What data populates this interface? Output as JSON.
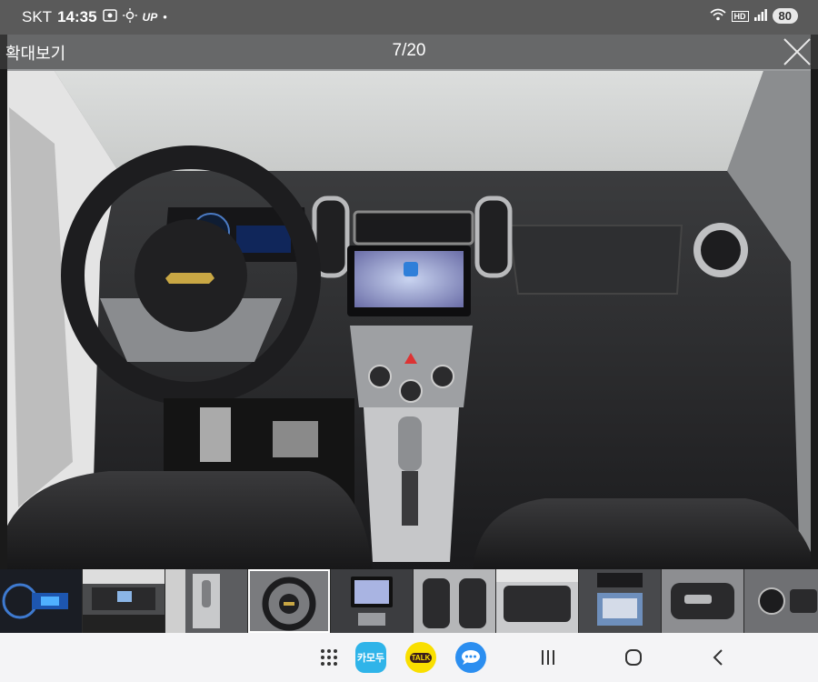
{
  "status_bar": {
    "carrier": "SKT",
    "time": "14:35",
    "indicators": [
      "screen-record-icon",
      "sun-icon",
      "up-icon",
      "dot-icon"
    ],
    "up_label": "UP",
    "network_label": "HD",
    "battery": "80"
  },
  "viewer": {
    "title": "확대보기",
    "counter": "7/20",
    "close_icon": "close-icon"
  },
  "thumbnails": {
    "count_visible": 10,
    "active_index": 3
  },
  "nav_bar": {
    "apps": [
      {
        "name": "app-drawer-icon",
        "label": ""
      },
      {
        "name": "kakao-t-icon",
        "label": "카모두",
        "color": "#2fb4e9"
      },
      {
        "name": "kakaotalk-icon",
        "label": "TALK",
        "color": "#f9df00"
      },
      {
        "name": "messages-icon",
        "label": "",
        "color": "#2b8ef0"
      }
    ],
    "buttons": [
      "recents-icon",
      "home-icon",
      "back-icon"
    ]
  }
}
